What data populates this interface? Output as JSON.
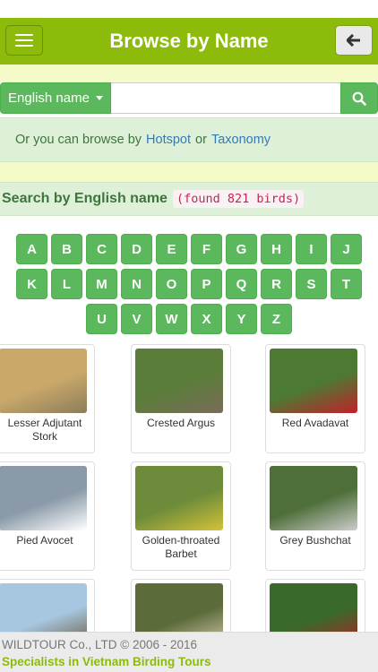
{
  "header": {
    "title": "Browse by Name"
  },
  "search": {
    "dropdown_label": "English name",
    "input_value": "",
    "placeholder": ""
  },
  "browse": {
    "prefix": "Or you can browse by",
    "hotspot_link": "Hotspot",
    "or_text": "or",
    "taxonomy_link": "Taxonomy"
  },
  "searchby": {
    "label": "Search by English name",
    "found": "(found 821 birds)"
  },
  "letters": {
    "row1": [
      "A",
      "B",
      "C",
      "D",
      "E",
      "F",
      "G",
      "H",
      "I",
      "J"
    ],
    "row2": [
      "K",
      "L",
      "M",
      "N",
      "O",
      "P",
      "Q",
      "R",
      "S",
      "T"
    ],
    "row3": [
      "U",
      "V",
      "W",
      "X",
      "Y",
      "Z"
    ]
  },
  "birds": [
    {
      "name": "Lesser Adjutant Stork",
      "thumb_colors": [
        "#c9a86a",
        "#8c7d5a"
      ]
    },
    {
      "name": "Crested Argus",
      "thumb_colors": [
        "#5b7d3a",
        "#7a6b5a"
      ]
    },
    {
      "name": "Red Avadavat",
      "thumb_colors": [
        "#4d7a33",
        "#c1202a"
      ]
    },
    {
      "name": "Pied Avocet",
      "thumb_colors": [
        "#8a9aa8",
        "#ffffff"
      ]
    },
    {
      "name": "Golden-throated Barbet",
      "thumb_colors": [
        "#6d8b3a",
        "#d4c23a"
      ]
    },
    {
      "name": "Grey Bushchat",
      "thumb_colors": [
        "#4f6f3a",
        "#cccccc"
      ]
    },
    {
      "name": "",
      "thumb_colors": [
        "#a7c7e0",
        "#6b5a40"
      ]
    },
    {
      "name": "",
      "thumb_colors": [
        "#5b6b3a",
        "#d8c8b0"
      ]
    },
    {
      "name": "",
      "thumb_colors": [
        "#3a6a2a",
        "#b0202a"
      ]
    }
  ],
  "footer": {
    "copyright": "WILDTOUR Co., LTD © 2006 - 2016",
    "tagline": "Specialists in Vietnam Birding Tours"
  },
  "colors": {
    "brand_green": "#8dbb0b",
    "button_green": "#5cb85c",
    "panel_green": "#dff0d8",
    "yellow_band": "#f4fbc9"
  }
}
